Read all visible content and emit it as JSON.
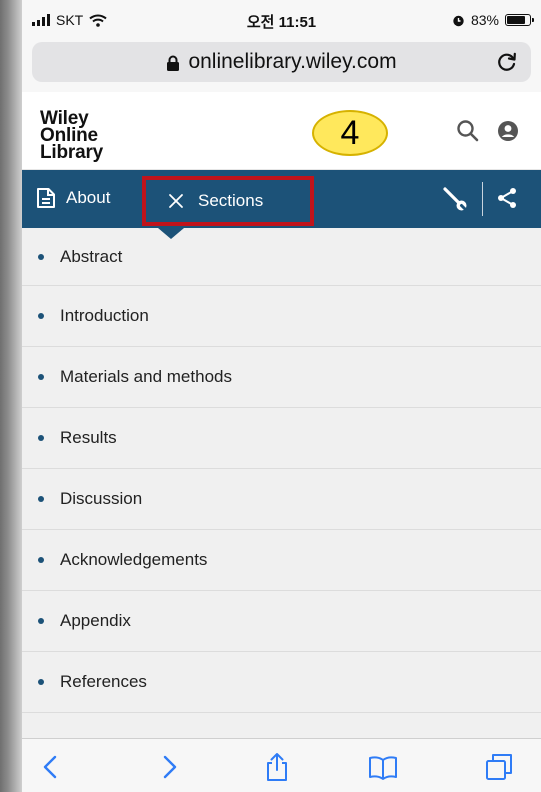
{
  "status_bar": {
    "carrier": "SKT",
    "time": "오전 11:51",
    "battery_percent": "83%",
    "battery_level": 0.83
  },
  "browser": {
    "url": "onlinelibrary.wiley.com",
    "icons": [
      "lock-icon",
      "reload-icon"
    ]
  },
  "header": {
    "logo_lines": [
      "Wiley",
      "Online",
      "Library"
    ],
    "step_badge": "4",
    "icons": [
      "search-icon",
      "account-icon"
    ]
  },
  "nav": {
    "about_label": "About",
    "sections_label": "Sections",
    "icons": [
      "document-icon",
      "close-icon",
      "wrench-icon",
      "share-icon"
    ],
    "accent_color": "#1c5278",
    "highlight_color": "#c0141b"
  },
  "sections": [
    {
      "label": "Abstract"
    },
    {
      "label": "Introduction"
    },
    {
      "label": "Materials and methods"
    },
    {
      "label": "Results"
    },
    {
      "label": "Discussion"
    },
    {
      "label": "Acknowledgements"
    },
    {
      "label": "Appendix"
    },
    {
      "label": "References"
    }
  ],
  "toolbar": {
    "icons": [
      "back-icon",
      "forward-icon",
      "share-icon",
      "bookmarks-icon",
      "tabs-icon"
    ]
  }
}
